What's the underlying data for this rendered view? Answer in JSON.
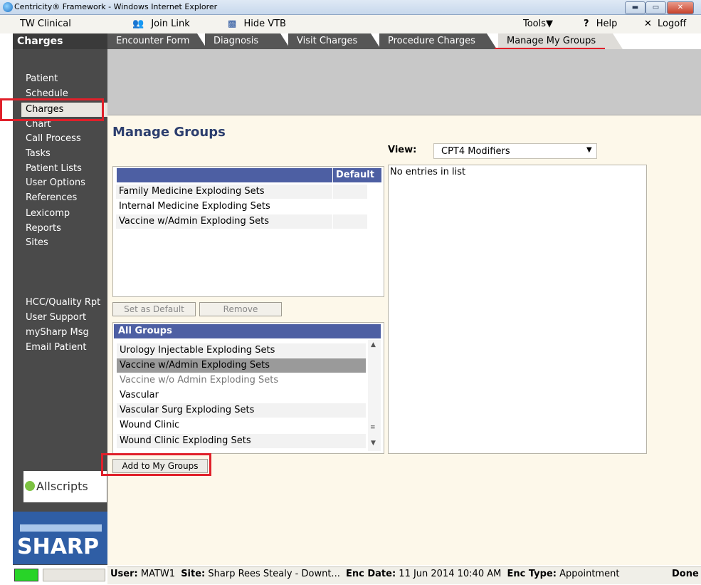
{
  "window": {
    "title": "Centricity® Framework - Windows Internet Explorer"
  },
  "toolbar": {
    "app_name": "TW Clinical",
    "join_link": "Join Link",
    "hide_vtb": "Hide VTB",
    "tools": "Tools",
    "help": "Help",
    "logoff": "Logoff"
  },
  "section_title": "Charges",
  "tabs": [
    "Encounter Form",
    "Diagnosis",
    "Visit Charges",
    "Procedure Charges",
    "Manage My Groups"
  ],
  "nav": {
    "items": [
      "Patient",
      "Schedule",
      "Charges",
      "Chart",
      "Call Process",
      "Tasks",
      "Patient Lists",
      "User Options",
      "References",
      "Lexicomp",
      "Reports",
      "Sites"
    ],
    "lower_items": [
      "HCC/Quality Rpt",
      "User Support",
      "mySharp Msg",
      "Email Patient"
    ],
    "allscripts": "Allscripts",
    "sharp": "SHARP"
  },
  "main": {
    "page_title": "Manage Groups",
    "view_label": "View:",
    "view_value": "CPT4 Modifiers",
    "my_groups_header": "Default",
    "my_groups": [
      "Family Medicine Exploding Sets",
      "Internal Medicine Exploding Sets",
      "Vaccine w/Admin Exploding Sets"
    ],
    "set_default_btn": "Set as Default",
    "remove_btn": "Remove",
    "all_groups_header": "All Groups",
    "all_groups": [
      "Urology Injectable Exploding Sets",
      "Vaccine w/Admin Exploding Sets",
      "Vaccine w/o Admin Exploding Sets",
      "Vascular",
      "Vascular Surg Exploding Sets",
      "Wound Clinic",
      "Wound Clinic Exploding Sets"
    ],
    "add_btn": "Add to My Groups",
    "empty_list": "No entries in list"
  },
  "status": {
    "user_label": "User:",
    "user": "MATW1",
    "site_label": "Site:",
    "site": "Sharp Rees Stealy - Downt...",
    "enc_date_label": "Enc Date:",
    "enc_date": "11 Jun 2014 10:40 AM",
    "enc_type_label": "Enc Type:",
    "enc_type": "Appointment",
    "done": "Done"
  },
  "colors": {
    "accent": "#4d5fa3",
    "highlight": "#e0202a"
  }
}
